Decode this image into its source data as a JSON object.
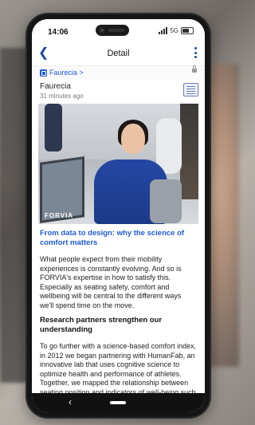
{
  "status": {
    "time": "14:06",
    "network": "5G"
  },
  "appbar": {
    "title": "Detail"
  },
  "source": {
    "link_label": "Faurecia >"
  },
  "article": {
    "source_name": "Faurecia",
    "timestamp": "31 minutes ago",
    "image_logo": "FORVIA",
    "headline": "From data to design: why the science of comfort matters",
    "paragraph1": "What people expect from their mobility experiences is constantly evolving. And so is FORVIA's expertise in how to satisfy this. Especially as seating safety, comfort and wellbeing will be central to the different ways we'll spend time on the move.",
    "subheading": "Research partners strengthen our understanding",
    "paragraph2": "To go further with a science-based comfort index, in 2012 we began partnering with HumanFab, an innovative lab that uses cognitive science to optimize health and performance of athletes. Together, we mapped the relationship between seating position and indicators of well-being such as blood pressure and flow, body temperature, and muscle stiffness. This led"
  },
  "icons": {
    "back": "chevron-left-icon",
    "more": "more-vertical-icon",
    "source": "source-badge-icon",
    "lock": "lock-icon",
    "article": "article-icon"
  }
}
